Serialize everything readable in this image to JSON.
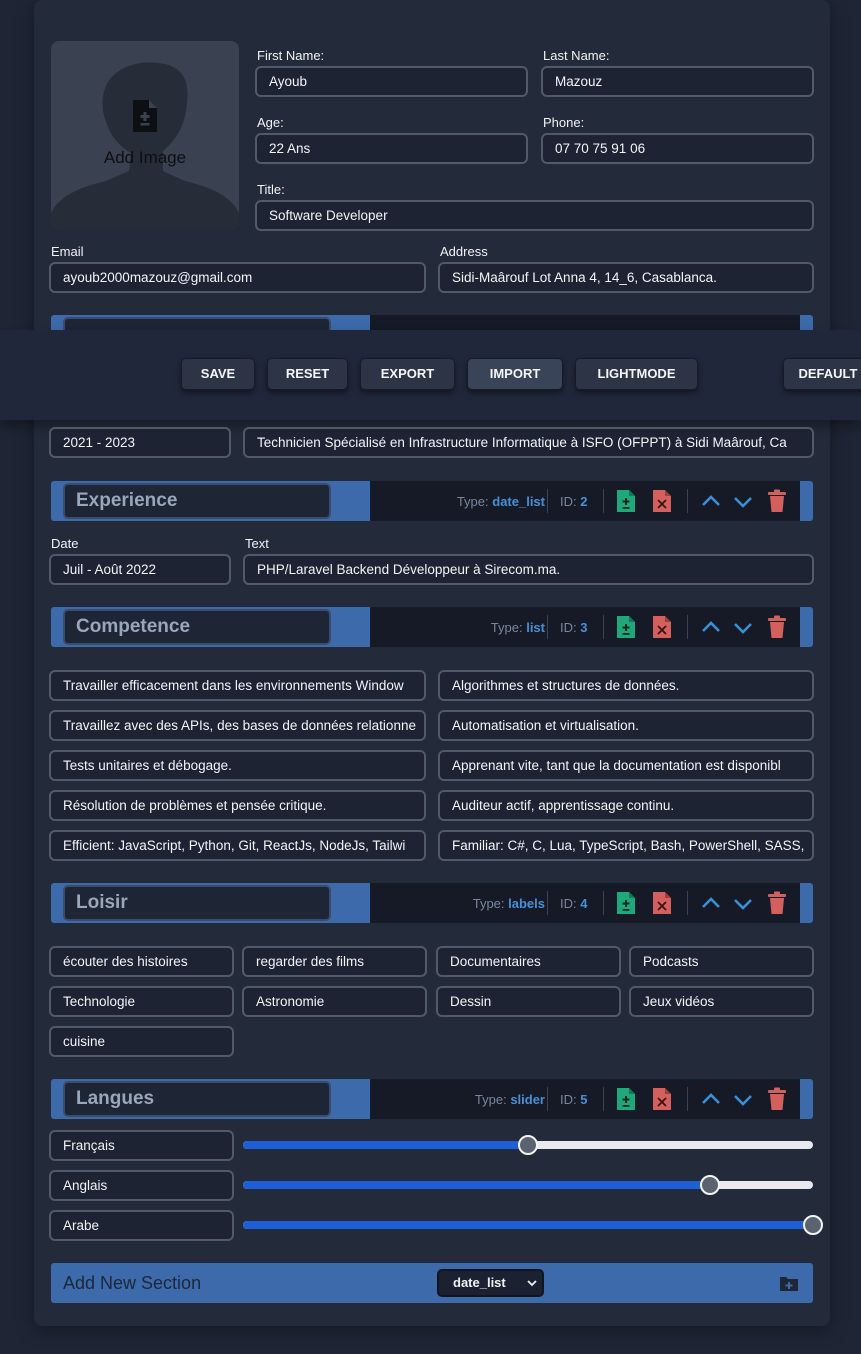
{
  "profile": {
    "add_image_label": "Add Image",
    "first_name_label": "First Name:",
    "first_name": "Ayoub",
    "last_name_label": "Last Name:",
    "last_name": "Mazouz",
    "age_label": "Age:",
    "age": "22 Ans",
    "phone_label": "Phone:",
    "phone": "07 70 75 91 06",
    "title_label": "Title:",
    "title": "Software Developer",
    "email_label": "Email",
    "email": "ayoub2000mazouz@gmail.com",
    "address_label": "Address",
    "address": "Sidi-Maârouf Lot Anna 4, 14_6, Casablanca."
  },
  "toolbar": {
    "save": "SAVE",
    "reset": "RESET",
    "export": "EXPORT",
    "import": "IMPORT",
    "lightmode": "LIGHTMODE",
    "default": "DEFAULT"
  },
  "education_row": {
    "date": "2021 - 2023",
    "text": "Technicien Spécialisé en Infrastructure Informatique à ISFO (OFPPT) à Sidi Maârouf, Ca"
  },
  "type_prefix": "Type:",
  "id_prefix": "ID:",
  "sections": [
    {
      "title": "Experience",
      "type": "date_list",
      "id": "2"
    },
    {
      "title": "Competence",
      "type": "list",
      "id": "3"
    },
    {
      "title": "Loisir",
      "type": "labels",
      "id": "4"
    },
    {
      "title": "Langues",
      "type": "slider",
      "id": "5"
    }
  ],
  "experience": {
    "date_label": "Date",
    "text_label": "Text",
    "date": "Juil - Août 2022",
    "text": "PHP/Laravel Backend Développeur à Sirecom.ma."
  },
  "competence": [
    "Travailler efficacement dans les environnements Window",
    "Algorithmes et structures de données.",
    "Travaillez avec des APIs, des bases de données relationne",
    "Automatisation et virtualisation.",
    "Tests unitaires et débogage.",
    "Apprenant vite, tant que la documentation est disponibl",
    "Résolution de problèmes et pensée critique.",
    "Auditeur actif, apprentissage continu.",
    "Efficient: JavaScript, Python, Git, ReactJs, NodeJs, Tailwi",
    "Familiar: C#, C, Lua, TypeScript, Bash, PowerShell, SASS,"
  ],
  "loisir": [
    "écouter des histoires",
    "regarder des films",
    "Documentaires",
    "Podcasts",
    "Technologie",
    "Astronomie",
    "Dessin",
    "Jeux vidéos",
    "cuisine"
  ],
  "langues": [
    {
      "name": "Français",
      "level": 0.5
    },
    {
      "name": "Anglais",
      "level": 0.82
    },
    {
      "name": "Arabe",
      "level": 1.0
    }
  ],
  "add_section": {
    "label": "Add New Section",
    "selected_type": "date_list"
  },
  "colors": {
    "accent": "#3d6aab",
    "add_icon": "#1fa87a",
    "remove_icon": "#d4605e",
    "arrow_icon": "#3a8fd6",
    "slider_fill": "#1e5fd8"
  }
}
